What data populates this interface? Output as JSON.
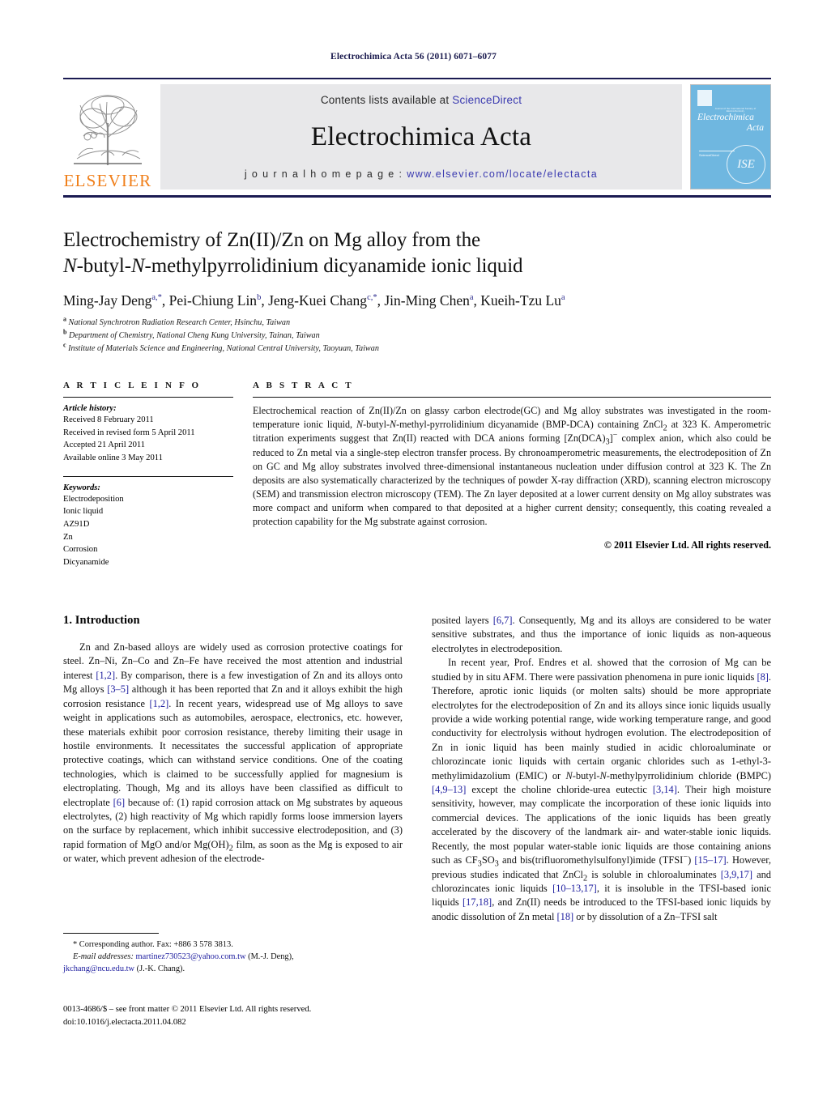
{
  "running_head": "Electrochimica Acta 56 (2011) 6071–6077",
  "masthead": {
    "contents_prefix": "Contents lists available at ",
    "sciencedirect": "ScienceDirect",
    "journal_name": "Electrochimica Acta",
    "homepage_prefix": "j o u r n a l   h o m e p a g e :  ",
    "homepage_url": "www.elsevier.com/locate/electacta",
    "publisher": "ELSEVIER",
    "publisher_logo": "elsevier-tree-logo",
    "cover": {
      "title_line1": "Electrochimica",
      "title_line2": "Acta",
      "society_line": "Journal of the International Society of Electrochemistry",
      "sciencedirect_tag": "ScienceDirect",
      "seal": "ISE"
    },
    "accent_link_color": "#3a3ab0",
    "elsevier_orange": "#f07f1a",
    "cover_blue": "#6fb7e0"
  },
  "article": {
    "title_line1": "Electrochemistry of Zn(II)/Zn on Mg alloy from the",
    "title_line2_a": "N",
    "title_line2_b": "-butyl-",
    "title_line2_c": "N",
    "title_line2_d": "-methylpyrrolidinium dicyanamide ionic liquid",
    "authors": [
      {
        "name": "Ming-Jay Deng",
        "marks": "a,*"
      },
      {
        "name": "Pei-Chiung Lin",
        "marks": "b"
      },
      {
        "name": "Jeng-Kuei Chang",
        "marks": "c,*"
      },
      {
        "name": "Jin-Ming Chen",
        "marks": "a"
      },
      {
        "name": "Kueih-Tzu Lu",
        "marks": "a"
      }
    ],
    "affiliations": [
      {
        "mark": "a",
        "text": "National Synchrotron Radiation Research Center, Hsinchu, Taiwan"
      },
      {
        "mark": "b",
        "text": "Department of Chemistry, National Cheng Kung University, Tainan, Taiwan"
      },
      {
        "mark": "c",
        "text": "Institute of Materials Science and Engineering, National Central University, Taoyuan, Taiwan"
      }
    ]
  },
  "article_info": {
    "heading": "A R T I C L E   I N F O",
    "history_label": "Article history:",
    "history": [
      "Received 8 February 2011",
      "Received in revised form 5 April 2011",
      "Accepted 21 April 2011",
      "Available online 3 May 2011"
    ],
    "keywords_label": "Keywords:",
    "keywords": [
      "Electrodeposition",
      "Ionic liquid",
      "AZ91D",
      "Zn",
      "Corrosion",
      "Dicyanamide"
    ]
  },
  "abstract": {
    "heading": "A B S T R A C T",
    "p1_a": "Electrochemical reaction of Zn(II)/Zn on glassy carbon electrode(GC) and Mg alloy substrates was investigated in the room-temperature ionic liquid, ",
    "p1_n1": "N",
    "p1_b": "-butyl-",
    "p1_n2": "N",
    "p1_c": "-methyl-pyrrolidinium dicyanamide (BMP-DCA) containing ZnCl",
    "p1_sub1": "2",
    "p1_d": " at 323 K. Amperometric titration experiments suggest that Zn(II) reacted with DCA anions forming [Zn(DCA)",
    "p1_sub2": "3",
    "p1_e": "]",
    "p1_sup1": "−",
    "p1_f": " complex anion, which also could be reduced to Zn metal via a single-step electron transfer process. By chronoamperometric measurements, the electrodeposition of Zn on GC and Mg alloy substrates involved three-dimensional instantaneous nucleation under diffusion control at 323 K. The Zn deposits are also systematically characterized by the techniques of powder X-ray diffraction (XRD), scanning electron microscopy (SEM) and transmission electron microscopy (TEM). The Zn layer deposited at a lower current density on Mg alloy substrates was more compact and uniform when compared to that deposited at a higher current density; consequently, this coating revealed a protection capability for the Mg substrate against corrosion.",
    "copyright": "© 2011 Elsevier Ltd. All rights reserved."
  },
  "introduction": {
    "section_number_title": "1.  Introduction",
    "left": {
      "p1_a": "Zn and Zn-based alloys are widely used as corrosion protective coatings for steel. Zn–Ni, Zn–Co and Zn–Fe have received the most attention and industrial interest ",
      "ref1": "[1,2]",
      "p1_b": ". By comparison, there is a few investigation of Zn and its alloys onto Mg alloys ",
      "ref2": "[3–5]",
      "p1_c": " although it has been reported that Zn and it alloys exhibit the high corrosion resistance ",
      "ref3": "[1,2]",
      "p1_d": ". In recent years, widespread use of Mg alloys to save weight in applications such as automobiles, aerospace, electronics, etc. however, these materials exhibit poor corrosion resistance, thereby limiting their usage in hostile environments. It necessitates the successful application of appropriate protective coatings, which can withstand service conditions. One of the coating technologies, which is claimed to be successfully applied for magnesium is electroplating. Though, Mg and its alloys have been classified as difficult to electroplate ",
      "ref4": "[6]",
      "p1_e": " because of: (1) rapid corrosion attack on Mg substrates by aqueous electrolytes, (2) high reactivity of Mg which rapidly forms loose immersion layers on the surface by replacement, which inhibit successive electrodeposition, and (3) rapid formation of MgO and/or Mg(OH)",
      "p1_sub": "2",
      "p1_f": " film, as soon as the Mg is exposed to air or water, which prevent adhesion of the electrode-"
    },
    "right": {
      "p_cont_a": "posited layers ",
      "ref5": "[6,7]",
      "p_cont_b": ". Consequently, Mg and its alloys are considered to be water sensitive substrates, and thus the importance of ionic liquids as non-aqueous electrolytes in electrodeposition.",
      "p2_a": "In recent year, Prof. Endres et al. showed that the corrosion of Mg can be studied by in situ AFM. There were passivation phenomena in pure ionic liquids ",
      "ref6": "[8]",
      "p2_b": ". Therefore, aprotic ionic liquids (or molten salts) should be more appropriate electrolytes for the electrodeposition of Zn and its alloys since ionic liquids usually provide a wide working potential range, wide working temperature range, and good conductivity for electrolysis without hydrogen evolution. The electrodeposition of Zn in ionic liquid has been mainly studied in acidic chloroaluminate or chlorozincate ionic liquids with certain organic chlorides such as 1-ethyl-3-methylimidazolium (EMIC) or ",
      "p2_n1": "N",
      "p2_c": "-butyl-",
      "p2_n2": "N",
      "p2_d": "-methylpyrrolidinium chloride (BMPC) ",
      "ref7": "[4,9–13]",
      "p2_e": " except the choline chloride-urea eutectic ",
      "ref8": "[3,14]",
      "p2_f": ". Their high moisture sensitivity, however, may complicate the incorporation of these ionic liquids into commercial devices. The applications of the ionic liquids has been greatly accelerated by the discovery of the landmark air- and water-stable ionic liquids. Recently, the most popular water-stable ionic liquids are those containing anions such as CF",
      "p2_sub1": "3",
      "p2_g": "SO",
      "p2_sub2": "3",
      "p2_h": " and bis(trifluoromethylsulfonyl)imide (TFSI",
      "p2_sup1": "−",
      "p2_i": ") ",
      "ref9": "[15–17]",
      "p2_j": ". However, previous studies indicated that ZnCl",
      "p2_sub3": "2",
      "p2_k": " is soluble in chloroaluminates ",
      "ref10": "[3,9,17]",
      "p2_l": " and chlorozincates ionic liquids ",
      "ref11": "[10–13,17]",
      "p2_m": ", it is insoluble in the TFSI-based ionic liquids ",
      "ref12": "[17,18]",
      "p2_n": ", and Zn(II) needs be introduced to the TFSI-based ionic liquids by anodic dissolution of Zn metal ",
      "ref13": "[18]",
      "p2_o": " or by dissolution of a Zn–TFSI salt"
    }
  },
  "footnote": {
    "corresponding": "* Corresponding author. Fax: +886 3 578 3813.",
    "email_label": "E-mail addresses:",
    "email1": "martinez730523@yahoo.com.tw",
    "email1_owner": " (M.-J. Deng),",
    "email2": "jkchang@ncu.edu.tw",
    "email2_owner": " (J.-K. Chang)."
  },
  "imprint": {
    "line1": "0013-4686/$ – see front matter © 2011 Elsevier Ltd. All rights reserved.",
    "line2": "doi:10.1016/j.electacta.2011.04.082"
  }
}
